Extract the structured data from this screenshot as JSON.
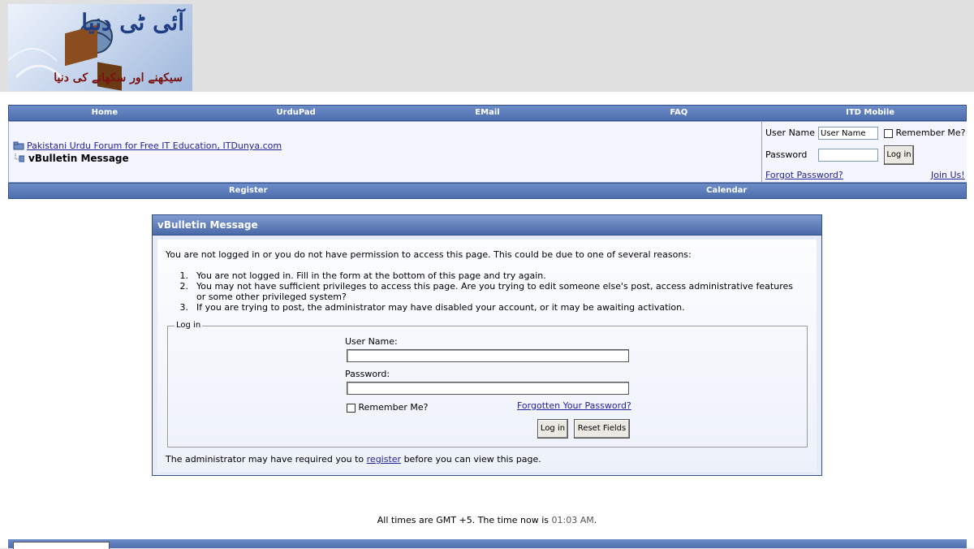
{
  "logo": {
    "title": "آئی ٹی دنیا",
    "subtitle": "سیکھنے اور سکھانے کی دنیا"
  },
  "nav": {
    "items": [
      "Home",
      "UrduPad",
      "EMail",
      "FAQ",
      "ITD Mobile"
    ]
  },
  "breadcrumb": {
    "forum_link": "Pakistani Urdu Forum for Free IT Education, ITDunya.com",
    "page_title": "vBulletin Message"
  },
  "login": {
    "username_label": "User Name",
    "username_value": "User Name",
    "remember_label": "Remember Me?",
    "password_label": "Password",
    "login_button": "Log in",
    "forgot_link": "Forgot Password?",
    "join_link": "Join Us!"
  },
  "nav2": {
    "items": [
      "Register",
      "Calendar"
    ]
  },
  "message": {
    "title": "vBulletin Message",
    "intro": "You are not logged in or you do not have permission to access this page. This could be due to one of several reasons:",
    "reasons": [
      "You are not logged in. Fill in the form at the bottom of this page and try again.",
      "You may not have sufficient privileges to access this page. Are you trying to edit someone else's post, access administrative features or some other privileged system?",
      "If you are trying to post, the administrator may have disabled your account, or it may be awaiting activation."
    ],
    "login_legend": "Log in",
    "username_label": "User Name:",
    "password_label": "Password:",
    "remember_label": "Remember Me?",
    "forgot_link": "Forgotten Your Password?",
    "login_button": "Log in",
    "reset_button": "Reset Fields",
    "footer_before": "The administrator may have required you to",
    "footer_link": "register",
    "footer_after": "before you can view this page."
  },
  "time": {
    "prefix": "All times are GMT +5. The time now is",
    "value": "01:03 AM",
    "suffix": "."
  },
  "colors": {
    "nav_bg": "#5676b8",
    "link": "#22229c",
    "panel_header": "#4a69a8"
  }
}
